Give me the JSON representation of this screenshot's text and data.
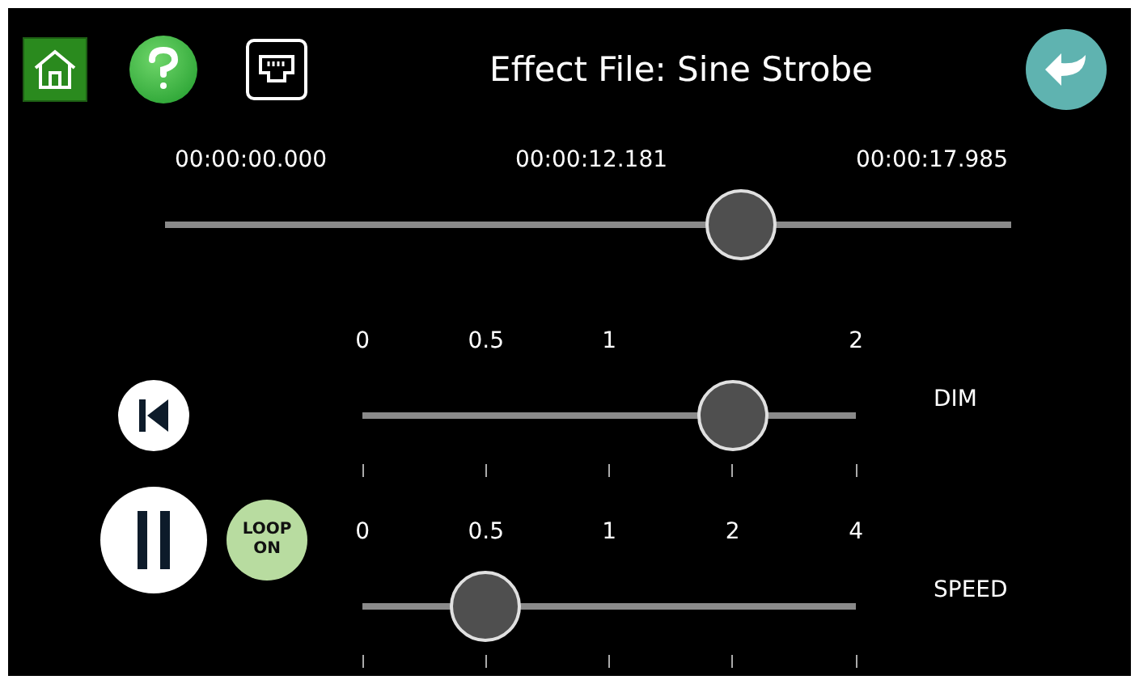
{
  "header": {
    "title": "Effect File: Sine Strobe"
  },
  "timeline": {
    "start": "00:00:00.000",
    "current": "00:00:12.181",
    "end": "00:00:17.985",
    "level": 0.68
  },
  "transport": {
    "loop": {
      "label_top": "LOOP",
      "label_bottom": "ON",
      "on": true
    }
  },
  "sliders": [
    {
      "name": "DIM",
      "level": 0.75,
      "ticks": [
        {
          "kind": "labeled",
          "label": "0"
        },
        {
          "kind": "labeled",
          "label": "0.5"
        },
        {
          "kind": "labeled",
          "label": "1"
        },
        {
          "kind": "unlabeled"
        },
        {
          "kind": "labeled",
          "label": "2"
        }
      ]
    },
    {
      "name": "SPEED",
      "level": 0.25,
      "ticks": [
        {
          "kind": "labeled",
          "label": "0"
        },
        {
          "kind": "labeled",
          "label": "0.5"
        },
        {
          "kind": "labeled",
          "label": "1"
        },
        {
          "kind": "labeled",
          "label": "2"
        },
        {
          "kind": "labeled",
          "label": "4"
        }
      ]
    }
  ]
}
